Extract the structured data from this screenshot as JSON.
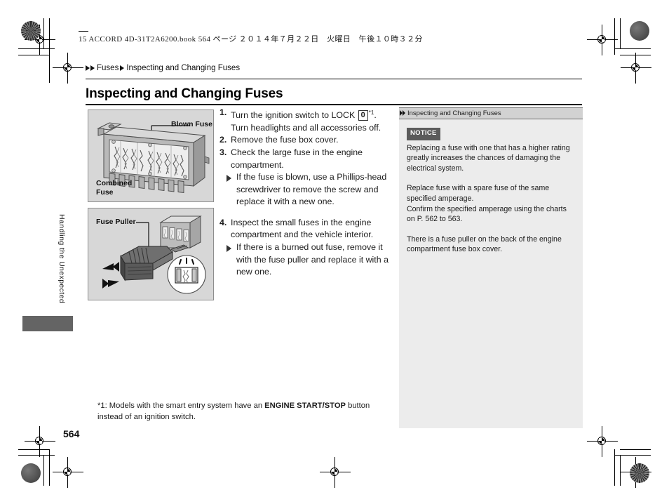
{
  "print_header": "15 ACCORD 4D-31T2A6200.book  564 ページ  ２０１４年７月２２日　火曜日　午後１０時３２分",
  "breadcrumb": {
    "parent": "Fuses",
    "current": "Inspecting and Changing Fuses"
  },
  "page_title": "Inspecting and Changing Fuses",
  "chapter_tab": "Handling the Unexpected",
  "page_number": "564",
  "figures": [
    {
      "name": "fuse-block-illustration",
      "labels": {
        "blown_fuse": "Blown Fuse",
        "combined_fuse": "Combined\nFuse"
      }
    },
    {
      "name": "fuse-puller-illustration",
      "labels": {
        "fuse_puller": "Fuse Puller"
      }
    }
  ],
  "steps": [
    {
      "num": "1.",
      "text_before_key": "Turn the ignition switch to LOCK ",
      "key": "0",
      "footnote_ref": "*1",
      "text_after_key": ". Turn headlights and all accessories off.",
      "sub": []
    },
    {
      "num": "2.",
      "text": "Remove the fuse box cover.",
      "sub": []
    },
    {
      "num": "3.",
      "text": "Check the large fuse in the engine compartment.",
      "sub": [
        "If the fuse is blown, use a Phillips-head screwdriver to remove the screw and replace it with a new one."
      ]
    },
    {
      "num": "4.",
      "text": "Inspect the small fuses in the engine compartment and the vehicle interior.",
      "sub": [
        "If there is a burned out fuse, remove it with the fuse puller and replace it with a new one."
      ]
    }
  ],
  "side_panel": {
    "header": "Inspecting and Changing Fuses",
    "notice_label": "NOTICE",
    "paragraphs": [
      "Replacing a fuse with one that has a higher rating greatly increases the chances of damaging the electrical system.",
      "Replace fuse with a spare fuse of the same specified amperage.\nConfirm the specified amperage using the charts on P. 562 to 563.",
      "There is a fuse puller on the back of the engine compartment fuse box cover."
    ]
  },
  "footnote": {
    "lead": "*1: Models with the smart entry system have an ",
    "bold": "ENGINE START/STOP",
    "tail": " button instead of an ignition switch."
  },
  "colors": {
    "panel_bg": "#ececec",
    "panel_header_bg": "#d2d2d2",
    "notice_bg": "#5b5b5b",
    "figure_bg": "#d7d7d7",
    "thumb_index": "#646464"
  }
}
